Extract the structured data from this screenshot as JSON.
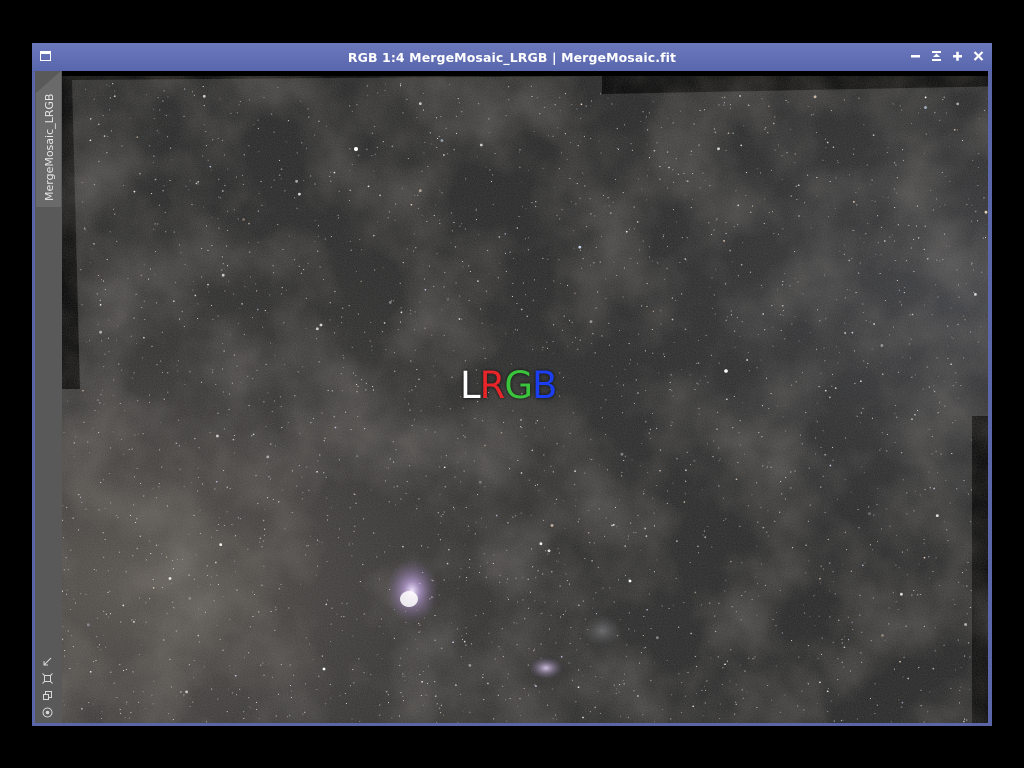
{
  "window": {
    "title": "RGB 1:4 MergeMosaic_LRGB | MergeMosaic.fit",
    "controls": [
      "minimize-icon",
      "shade-icon",
      "maximize-icon",
      "close-icon"
    ]
  },
  "sidebar": {
    "tab_label": "MergeMosaic_LRGB",
    "tools": [
      "fit-view-icon",
      "zoom-icon",
      "clone-icon",
      "mask-icon"
    ]
  },
  "image": {
    "overlay_letters": [
      {
        "char": "L",
        "color": "#ffffff"
      },
      {
        "char": "R",
        "color": "#e8262a"
      },
      {
        "char": "G",
        "color": "#39c43c"
      },
      {
        "char": "B",
        "color": "#1b3ff0"
      }
    ]
  },
  "colors": {
    "frame": "#5a66a8",
    "sidebar": "#595959",
    "background": "#000000"
  }
}
